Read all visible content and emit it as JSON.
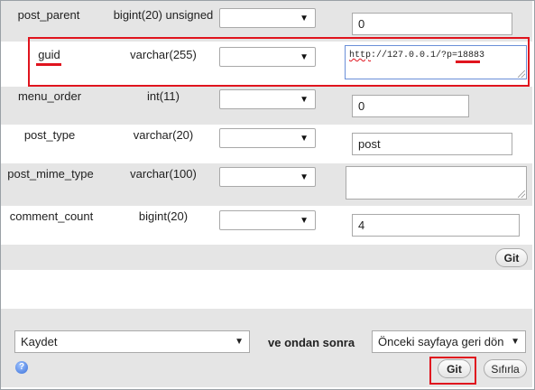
{
  "rows": [
    {
      "name": "post_parent",
      "type": "bigint(20) unsigned",
      "value": "0"
    },
    {
      "name": "guid",
      "type": "varchar(255)",
      "value_prefix": "http",
      "value_rest": "://127.0.0.1/?p=18883"
    },
    {
      "name": "menu_order",
      "type": "int(11)",
      "value": "0"
    },
    {
      "name": "post_type",
      "type": "varchar(20)",
      "value": "post"
    },
    {
      "name": "post_mime_type",
      "type": "varchar(100)",
      "value": ""
    },
    {
      "name": "comment_count",
      "type": "bigint(20)",
      "value": "4"
    }
  ],
  "go_label": "Git",
  "footer": {
    "action_value": "Kaydet",
    "then_label": "ve ondan sonra",
    "after_value": "Önceki sayfaya geri dön",
    "go_label": "Git",
    "reset_label": "Sıfırla",
    "help_glyph": "?"
  },
  "icons": {
    "select_arrow": "▼"
  },
  "colors": {
    "highlight": "#e0141e",
    "row_alt": "#e5e5e5"
  }
}
